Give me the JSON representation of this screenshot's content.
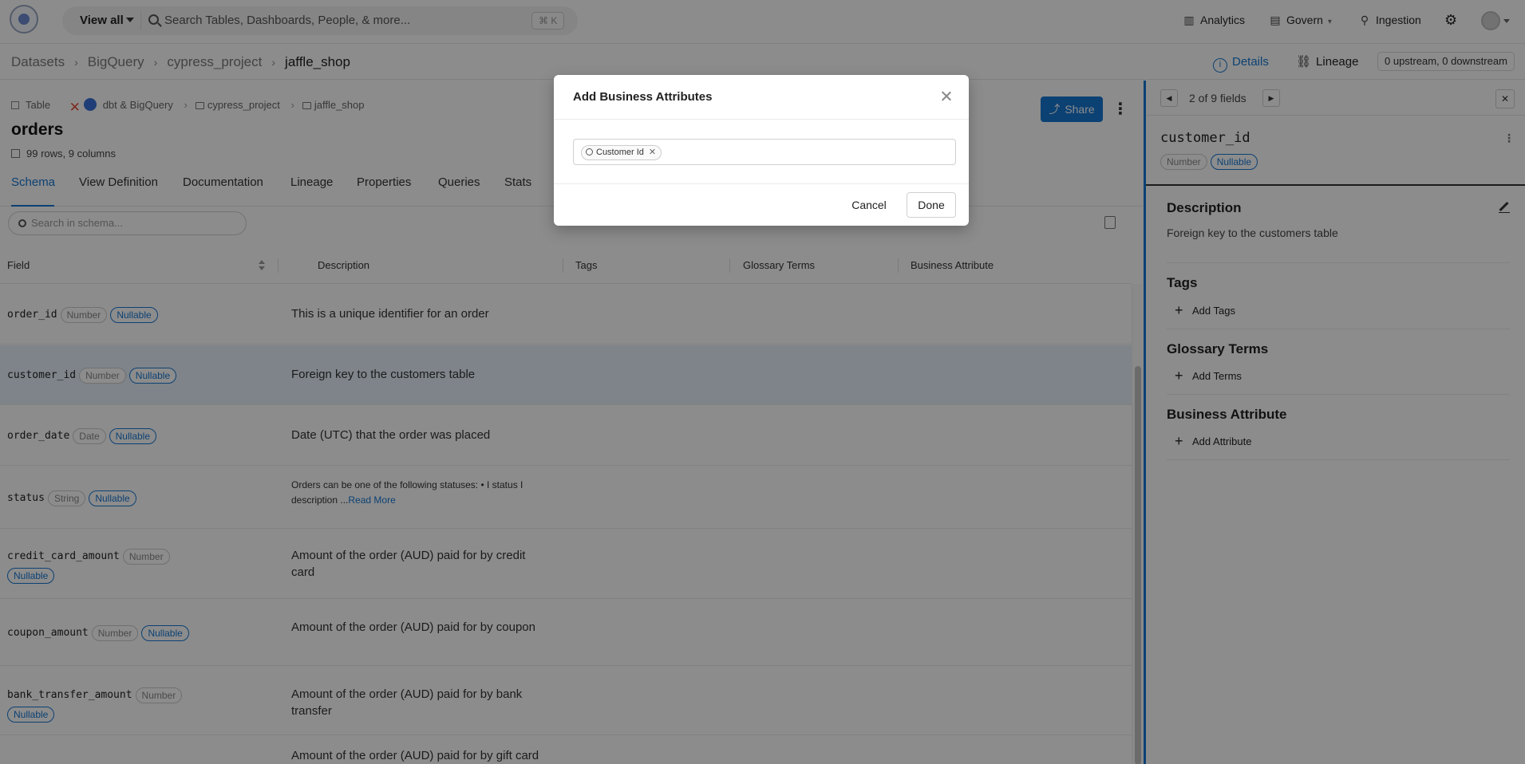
{
  "topnav": {
    "view_all": "View all",
    "search_placeholder": "Search Tables, Dashboards, People, & more...",
    "shortcut": "⌘ K",
    "analytics": "Analytics",
    "govern": "Govern",
    "ingestion": "Ingestion"
  },
  "breadcrumb": [
    "Datasets",
    "BigQuery",
    "cypress_project",
    "jaffle_shop"
  ],
  "header_tabs": {
    "details": "Details",
    "lineage": "Lineage",
    "upstream": "0 upstream, 0 downstream"
  },
  "entity": {
    "type": "Table",
    "platform": "dbt & BigQuery",
    "path": [
      "cypress_project",
      "jaffle_shop"
    ],
    "name": "orders",
    "stats": "99 rows, 9 columns",
    "share": "Share"
  },
  "tabs": [
    "Schema",
    "View Definition",
    "Documentation",
    "Lineage",
    "Properties",
    "Queries",
    "Stats"
  ],
  "schema_search_placeholder": "Search in schema...",
  "columns": [
    "Field",
    "Description",
    "Tags",
    "Glossary Terms",
    "Business Attribute"
  ],
  "rows": [
    {
      "field": "order_id",
      "type": "Number",
      "nullable": "Nullable",
      "description": "This is a unique identifier for an order"
    },
    {
      "field": "customer_id",
      "type": "Number",
      "nullable": "Nullable",
      "description": "Foreign key to the customers table"
    },
    {
      "field": "order_date",
      "type": "Date",
      "nullable": "Nullable",
      "description": "Date (UTC) that the order was placed"
    },
    {
      "field": "status",
      "type": "String",
      "nullable": "Nullable",
      "description": "Orders can be one of the following statuses: • I status I description ...",
      "read_more": "Read More"
    },
    {
      "field": "credit_card_amount",
      "type": "Number",
      "nullable": "Nullable",
      "description": "Amount of the order (AUD) paid for by credit card"
    },
    {
      "field": "coupon_amount",
      "type": "Number",
      "nullable": "Nullable",
      "description": "Amount of the order (AUD) paid for by coupon"
    },
    {
      "field": "bank_transfer_amount",
      "type": "Number",
      "nullable": "Nullable",
      "description": "Amount of the order (AUD) paid for by bank transfer"
    },
    {
      "field": "",
      "type": "",
      "nullable": "",
      "description": "Amount of the order (AUD) paid for by gift card"
    }
  ],
  "side_panel": {
    "counter": "2 of 9 fields",
    "field": "customer_id",
    "type": "Number",
    "nullable": "Nullable",
    "description_title": "Description",
    "description": "Foreign key to the customers table",
    "tags_title": "Tags",
    "add_tags": "Add Tags",
    "glossary_title": "Glossary Terms",
    "add_terms": "Add Terms",
    "business_title": "Business Attribute",
    "add_attribute": "Add Attribute"
  },
  "modal": {
    "title": "Add Business Attributes",
    "selected_tag": "Customer Id",
    "cancel": "Cancel",
    "done": "Done"
  },
  "colors": {
    "accent": "#1677d2",
    "selected_row": "#e6f0fb"
  }
}
